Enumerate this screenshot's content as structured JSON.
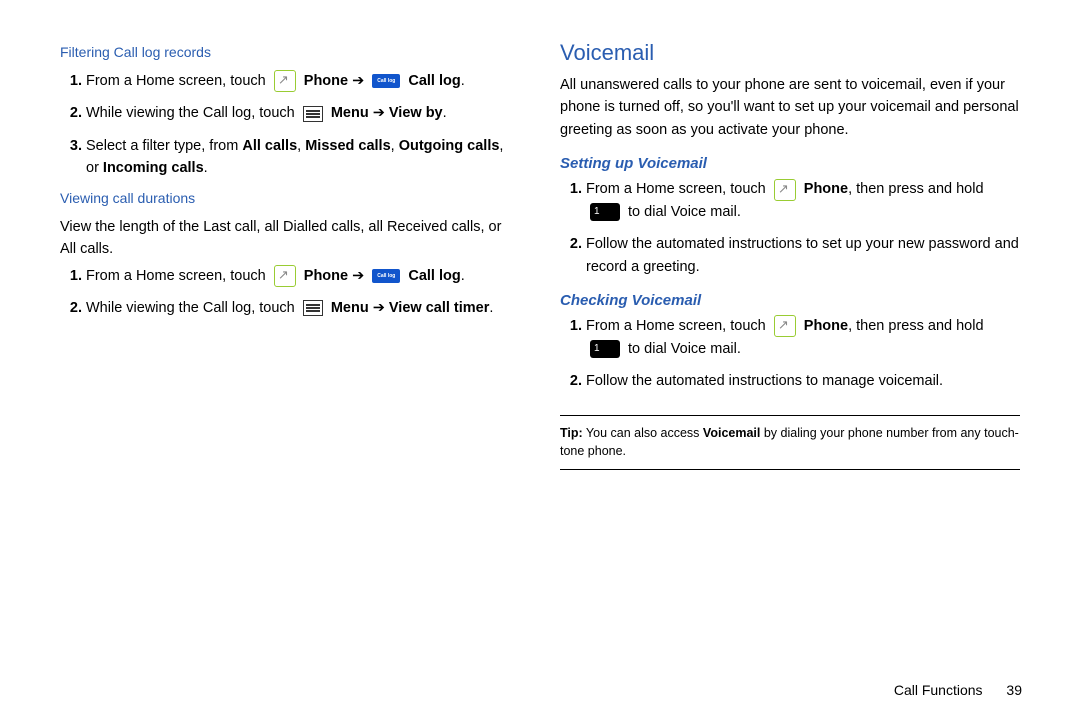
{
  "left": {
    "sec1_title": "Filtering Call log records",
    "sec1_s1_a": "From a Home screen, touch ",
    "sec1_s1_phone": "Phone",
    "sec1_s1_calllog": "Call log",
    "sec1_s2_a": "While viewing the Call log, touch ",
    "sec1_s2_menu": "Menu",
    "arrow": " ➔ ",
    "sec1_s2_viewby": "View by",
    "sec1_s3": "Select a filter type, from ",
    "sec1_s3_b1": "All calls",
    "sec1_s3_b2": "Missed calls",
    "sec1_s3_b3": "Outgoing calls",
    "sec1_s3_b4": "Incoming calls",
    "sec2_title": "Viewing call durations",
    "sec2_intro": "View the length of the Last call, all Dialled calls, all Received calls, or All calls.",
    "sec2_s1_a": "From a Home screen, touch ",
    "sec2_s1_phone": "Phone",
    "sec2_s1_calllog": "Call log",
    "sec2_s2_a": "While viewing the Call log, touch ",
    "sec2_s2_menu": "Menu",
    "sec2_s2_vct": "View call timer"
  },
  "right": {
    "h2": "Voicemail",
    "intro": "All unanswered calls to your phone are sent to voicemail, even if your phone is turned off, so you'll want to set up your voicemail and personal greeting as soon as you activate your phone.",
    "h3a": "Setting up Voicemail",
    "a1_a": "From a Home screen, touch ",
    "a1_phone": "Phone",
    "a1_b": ", then press and hold ",
    "a1_c": " to dial Voice mail.",
    "a2": "Follow the automated instructions to set up your new password and record a greeting.",
    "h3b": "Checking Voicemail",
    "b1_a": "From a Home screen, touch ",
    "b1_phone": "Phone",
    "b1_b": ", then press and hold ",
    "b1_c": " to dial Voice mail.",
    "b2": "Follow the automated instructions to manage voicemail.",
    "tip_label": "Tip:",
    "tip_a": " You can also access ",
    "tip_b": "Voicemail",
    "tip_c": " by dialing your phone number from any touch-tone phone."
  },
  "footer": {
    "section": "Call Functions",
    "page": "39"
  },
  "icons": {
    "calllog_text": "Call log",
    "key1_text": "1 ෮"
  }
}
